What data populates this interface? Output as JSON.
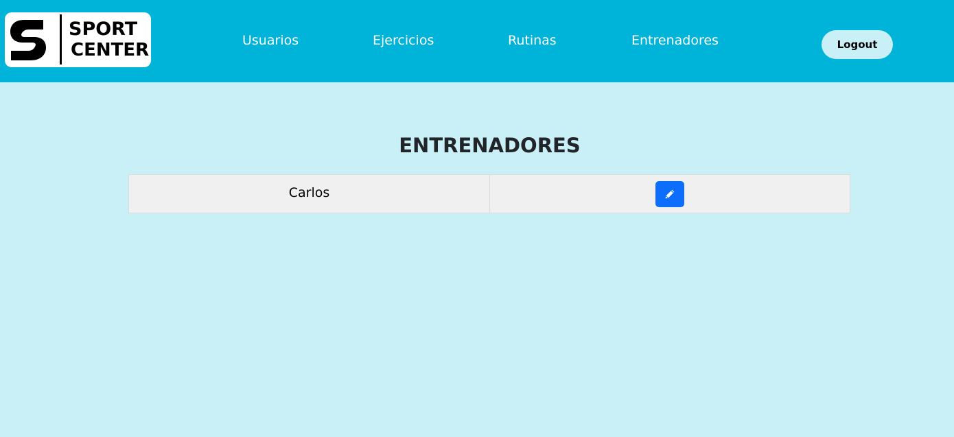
{
  "brand": {
    "line1": "SPORT",
    "line2": "CENTER",
    "icon": "sport-center-s-logo"
  },
  "nav": {
    "items": [
      {
        "label": "Usuarios"
      },
      {
        "label": "Ejercicios"
      },
      {
        "label": "Rutinas"
      },
      {
        "label": "Entrenadores"
      }
    ],
    "logout_label": "Logout"
  },
  "main": {
    "title": "ENTRENADORES",
    "rows": [
      {
        "name": "Carlos",
        "action_icon": "pencil-icon"
      }
    ]
  },
  "colors": {
    "navbar_bg": "#00b3d9",
    "page_bg": "#c9f0f7",
    "edit_button": "#0d6efd"
  }
}
